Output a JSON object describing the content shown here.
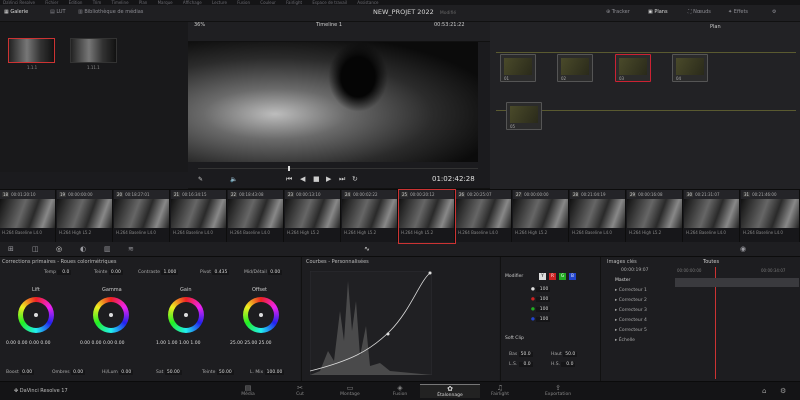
{
  "menubar": {
    "items": [
      "DaVinci Resolve",
      "Fichier",
      "Édition",
      "Trim",
      "Timeline",
      "Plan",
      "Marque",
      "Affichage",
      "Lecture",
      "Fusion",
      "Couleur",
      "Fairlight",
      "Espace de travail",
      "Assistance"
    ]
  },
  "toolbar": {
    "galerie": "Galerie",
    "lut": "LUT",
    "bibliotheque": "Bibliothèque de médias",
    "project_title": "NEW_PROJET 2022",
    "project_status": "Modifié",
    "tracker": "Tracker",
    "plans": "Plans",
    "noeuds": "Nœuds",
    "effets": "Effets"
  },
  "gallery": {
    "stills": [
      {
        "label": "1.1.1"
      },
      {
        "label": "1.11.1"
      }
    ]
  },
  "viewer": {
    "zoom": "36%",
    "timeline": "Timeline 1",
    "timecode_top": "00:53:21:22",
    "timecode": "01:02:42:28"
  },
  "nodes": {
    "mode": "Plan",
    "items": [
      {
        "label": "01"
      },
      {
        "label": "02"
      },
      {
        "label": "03"
      },
      {
        "label": "04"
      },
      {
        "label": "05"
      }
    ]
  },
  "clips": [
    {
      "n": "18",
      "tc": "00:01:20:10",
      "v": "V1",
      "codec": "H.264 Baseline L4.0"
    },
    {
      "n": "19",
      "tc": "00:00:00:00",
      "v": "V1",
      "codec": "H.264 High L5.2"
    },
    {
      "n": "20",
      "tc": "00:18:27:01",
      "v": "V1",
      "codec": "H.264 Baseline L4.0"
    },
    {
      "n": "21",
      "tc": "00:16:34:15",
      "v": "V1",
      "codec": "H.264 Baseline L4.0"
    },
    {
      "n": "22",
      "tc": "00:18:43:08",
      "v": "V1",
      "codec": "H.264 Baseline L4.0"
    },
    {
      "n": "23",
      "tc": "00:00:13:10",
      "v": "V1",
      "codec": "H.264 High L5.2"
    },
    {
      "n": "24",
      "tc": "00:00:02:22",
      "v": "V1",
      "codec": "H.264 High L5.2"
    },
    {
      "n": "25",
      "tc": "00:00:20:12",
      "v": "V1",
      "codec": "H.264 High L5.2"
    },
    {
      "n": "26",
      "tc": "00:20:25:07",
      "v": "V1",
      "codec": "H.264 Baseline L4.0"
    },
    {
      "n": "27",
      "tc": "00:00:00:00",
      "v": "V1",
      "codec": "H.264 High L5.2"
    },
    {
      "n": "28",
      "tc": "00:21:04:19",
      "v": "V1",
      "codec": "H.264 Baseline L4.0"
    },
    {
      "n": "29",
      "tc": "00:00:16:08",
      "v": "V1",
      "codec": "H.264 High L5.2"
    },
    {
      "n": "30",
      "tc": "00:21:31:07",
      "v": "V1",
      "codec": "H.264 Baseline L4.0"
    },
    {
      "n": "31",
      "tc": "00:21:46:00",
      "v": "V1",
      "codec": "H.264 Baseline L4.0"
    }
  ],
  "primaries": {
    "title": "Corrections primaires - Roues colorimétriques",
    "temp_label": "Temp",
    "temp": "0.0",
    "teinte_label": "Teinte",
    "teinte": "0.00",
    "contraste_label": "Contraste",
    "contraste": "1.000",
    "pivot_label": "Pivot",
    "pivot": "0.435",
    "middetail_label": "Mid/Détail",
    "middetail": "0.00",
    "wheels": [
      {
        "label": "Lift",
        "values": [
          "0.00",
          "0.00",
          "0.00",
          "0.00"
        ]
      },
      {
        "label": "Gamma",
        "values": [
          "0.00",
          "0.00",
          "0.00",
          "0.00"
        ]
      },
      {
        "label": "Gain",
        "values": [
          "1.00",
          "1.00",
          "1.00",
          "1.00"
        ]
      },
      {
        "label": "Offset",
        "values": [
          "25.00",
          "25.00",
          "25.00"
        ]
      }
    ],
    "bottom": {
      "boost_label": "Boost",
      "boost": "0.00",
      "ombres_label": "Ombres",
      "ombres": "0.00",
      "hlum_label": "Hi/Lum",
      "hlum": "0.00",
      "sat_label": "Sat",
      "sat": "50.00",
      "teinte_label": "Teinte",
      "teinte": "50.00",
      "lmix_label": "L. Mix",
      "lmix": "100.00"
    }
  },
  "curves": {
    "title": "Courbes - Personnalisées"
  },
  "modifier": {
    "label": "Modifier",
    "channels": [
      "Y",
      "R",
      "G",
      "B"
    ],
    "values": [
      "100",
      "100",
      "100",
      "100"
    ],
    "softclip_label": "Soft Clip",
    "bas_label": "Bas",
    "bas": "50.0",
    "haut_label": "Haut",
    "haut": "50.0",
    "ls_label": "L.S.",
    "ls": "0.0",
    "hs_label": "H.S.",
    "hs": "0.0"
  },
  "keyframes": {
    "title": "Images clés",
    "filter": "Toutes",
    "timecode": "00:00:19:07",
    "start_label": "00:00:00:00",
    "end_label": "00:00:34:07",
    "tracks": [
      "Master",
      "Correcteur 1",
      "Correcteur 2",
      "Correcteur 3",
      "Correcteur 4",
      "Correcteur 5",
      "Échelle"
    ]
  },
  "bottombar": {
    "app": "DaVinci Resolve 17",
    "pages": [
      "Média",
      "Cut",
      "Montage",
      "Fusion",
      "Étalonnage",
      "Fairlight",
      "Exportation"
    ]
  }
}
